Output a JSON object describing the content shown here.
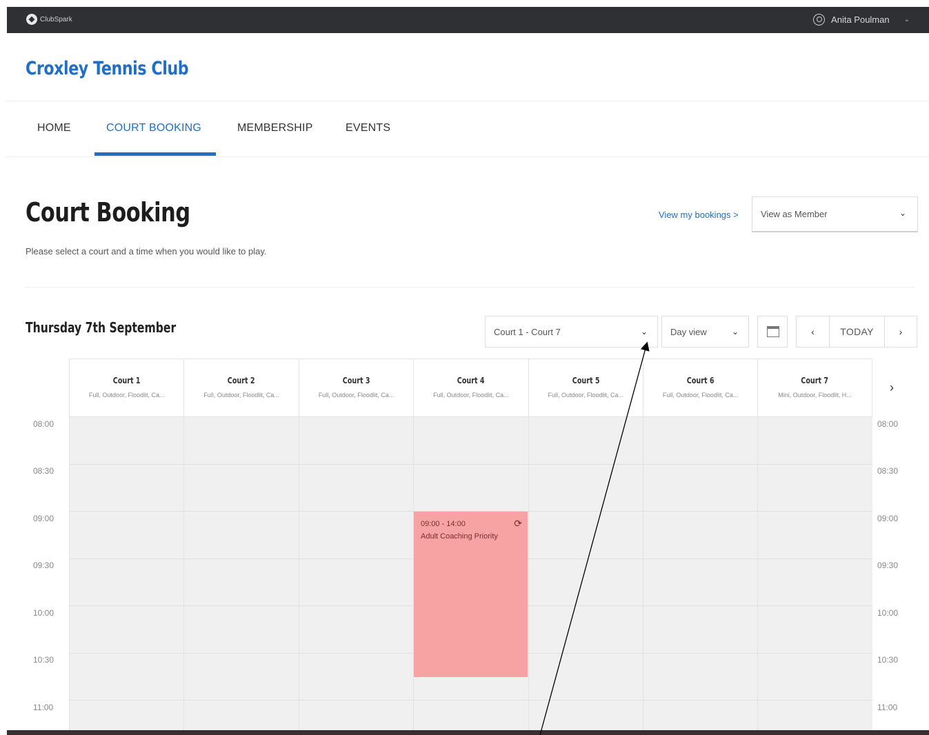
{
  "topbar": {
    "brand": "ClubSpark",
    "user_name": "Anita Poulman"
  },
  "club": {
    "title": "Croxley Tennis Club"
  },
  "nav": {
    "items": [
      {
        "label": "HOME"
      },
      {
        "label": "COURT BOOKING"
      },
      {
        "label": "MEMBERSHIP"
      },
      {
        "label": "EVENTS"
      }
    ],
    "active": "COURT BOOKING"
  },
  "page": {
    "title": "Court Booking",
    "subtitle": "Please select a court and a time when you would like to play.",
    "view_bookings": "View my bookings >",
    "view_as": "View as Member"
  },
  "schedule": {
    "date": "Thursday 7th September",
    "court_range": "Court 1 - Court 7",
    "view_mode": "Day view",
    "today_label": "TODAY",
    "prev_label": "‹",
    "next_label": "›",
    "more_label": "›",
    "courts": [
      {
        "name": "Court 1",
        "desc": "Full, Outdoor, Floodlit, Ca..."
      },
      {
        "name": "Court 2",
        "desc": "Full, Outdoor, Floodlit, Ca..."
      },
      {
        "name": "Court 3",
        "desc": "Full, Outdoor, Floodlit, Ca..."
      },
      {
        "name": "Court 4",
        "desc": "Full, Outdoor, Floodlit, Ca..."
      },
      {
        "name": "Court 5",
        "desc": "Full, Outdoor, Floodlit, Ca..."
      },
      {
        "name": "Court 6",
        "desc": "Full, Outdoor, Floodlit, Ca..."
      },
      {
        "name": "Court 7",
        "desc": "Mini, Outdoor, Floodlit, H..."
      }
    ],
    "times": [
      "08:00",
      "08:30",
      "09:00",
      "09:30",
      "10:00",
      "10:30",
      "11:00"
    ],
    "booking": {
      "court": "Court 4",
      "time": "09:00 - 14:00",
      "label": "Adult Coaching Priority"
    }
  },
  "colors": {
    "brand_blue": "#1f6fc5",
    "topbar": "#2e3033",
    "booking": "#f7a3a3",
    "slot_bg": "#f0f0f0"
  },
  "icons": {
    "brand": "clubspark-logo-icon",
    "user": "user-circle-icon",
    "calendar": "calendar-icon",
    "repeat": "repeat-icon"
  }
}
